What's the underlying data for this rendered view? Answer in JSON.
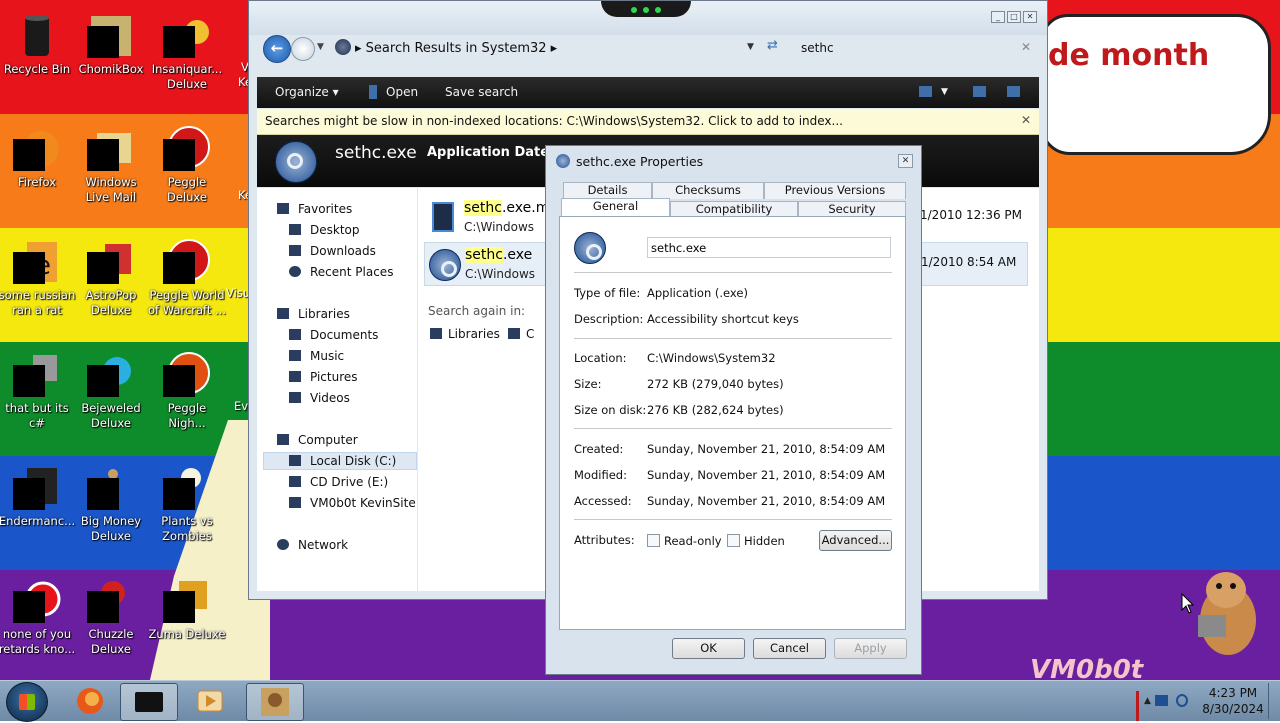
{
  "desktop": {
    "speech_text": "de month",
    "watermark": "VM0b0t",
    "colors": [
      "#e8141c",
      "#f77c19",
      "#f4e80e",
      "#0e8b2a",
      "#1a56c9",
      "#6a1fa0"
    ],
    "icons": [
      {
        "label": "Recycle Bin"
      },
      {
        "label": "ChomikBox"
      },
      {
        "label": "Insaniquar...\nDeluxe"
      },
      {
        "label": "Firefox"
      },
      {
        "label": "Windows\nLive Mail"
      },
      {
        "label": "Peggle\nDeluxe"
      },
      {
        "label": "some russian\nran a rat"
      },
      {
        "label": "AstroPop\nDeluxe"
      },
      {
        "label": "Peggle World\nof Warcraft ..."
      },
      {
        "label": "that but its\nc#"
      },
      {
        "label": "Bejeweled\nDeluxe"
      },
      {
        "label": "Peggle\nNigh..."
      },
      {
        "label": "Endermanc..."
      },
      {
        "label": "Big Money\nDeluxe"
      },
      {
        "label": "Plants vs\nZombies"
      },
      {
        "label": "none of you\nretards kno..."
      },
      {
        "label": "Chuzzle\nDeluxe"
      },
      {
        "label": "Zuma Deluxe"
      }
    ],
    "partial_labels": [
      "V",
      "Ke",
      "Ke",
      "Visu",
      "Eve"
    ]
  },
  "explorer": {
    "address": "Search Results in System32",
    "search_value": "sethc",
    "toolbar": {
      "organize": "Organize",
      "open": "Open",
      "save_search": "Save search"
    },
    "infobar": "Searches might be slow in non-indexed locations: C:\\Windows\\System32. Click to add to index...",
    "details": {
      "name": "sethc.exe",
      "type": "Application  Date r"
    },
    "nav": {
      "favorites": "Favorites",
      "desktop": "Desktop",
      "downloads": "Downloads",
      "recent": "Recent Places",
      "libraries": "Libraries",
      "documents": "Documents",
      "music": "Music",
      "pictures": "Pictures",
      "videos": "Videos",
      "computer": "Computer",
      "local_disk": "Local Disk (C:)",
      "cd_drive": "CD Drive (E:)",
      "vm": "VM0b0t KevinSite",
      "network": "Network"
    },
    "results": [
      {
        "name_hl": "sethc",
        "name_rest": ".exe.m",
        "path": "C:\\Windows",
        "date": "1/2010 12:36 PM"
      },
      {
        "name_hl": "sethc",
        "name_rest": ".exe",
        "path": "C:\\Windows",
        "date": "1/2010 8:54 AM"
      }
    ],
    "search_again": "Search again in:",
    "search_again_items": {
      "libraries": "Libraries",
      "computer": "C"
    }
  },
  "props": {
    "title": "sethc.exe Properties",
    "tabs_back": {
      "details": "Details",
      "checksums": "Checksums",
      "previous": "Previous Versions"
    },
    "tabs_front": {
      "general": "General",
      "compat": "Compatibility",
      "security": "Security"
    },
    "filename": "sethc.exe",
    "type_label": "Type of file:",
    "type_value": "Application (.exe)",
    "desc_label": "Description:",
    "desc_value": "Accessibility shortcut keys",
    "loc_label": "Location:",
    "loc_value": "C:\\Windows\\System32",
    "size_label": "Size:",
    "size_value": "272 KB (279,040 bytes)",
    "disk_label": "Size on disk:",
    "disk_value": "276 KB (282,624 bytes)",
    "created_label": "Created:",
    "created_value": "Sunday, November 21, 2010, 8:54:09 AM",
    "modified_label": "Modified:",
    "modified_value": "Sunday, November 21, 2010, 8:54:09 AM",
    "accessed_label": "Accessed:",
    "accessed_value": "Sunday, November 21, 2010, 8:54:09 AM",
    "attr_label": "Attributes:",
    "readonly": "Read-only",
    "hidden": "Hidden",
    "advanced": "Advanced...",
    "ok": "OK",
    "cancel": "Cancel",
    "apply": "Apply"
  },
  "taskbar": {
    "time": "4:23 PM",
    "date": "8/30/2024"
  }
}
